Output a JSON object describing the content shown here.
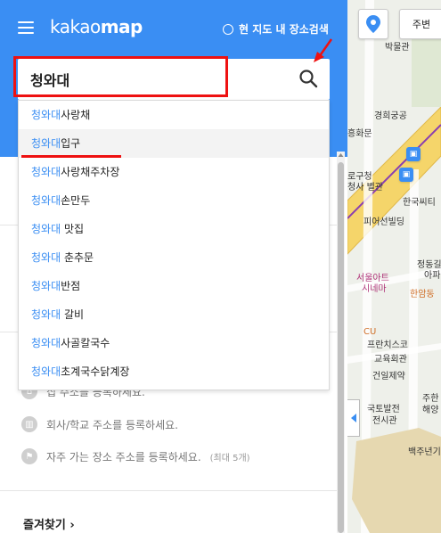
{
  "header": {
    "logo_light": "kakao",
    "logo_bold": "map",
    "area_search_label": "현 지도 내 장소검색"
  },
  "search": {
    "value": "청와대",
    "icon": "search-icon"
  },
  "suggestions": [
    {
      "highlight": "청와대",
      "rest": "사랑채"
    },
    {
      "highlight": "청와대",
      "rest": "입구"
    },
    {
      "highlight": "청와대",
      "rest": "사랑채주차장"
    },
    {
      "highlight": "청와대",
      "rest": "손만두"
    },
    {
      "highlight": "청와대",
      "rest": " 맛집"
    },
    {
      "highlight": "청와대",
      "rest": " 춘추문"
    },
    {
      "highlight": "청와대",
      "rest": "반점"
    },
    {
      "highlight": "청와대",
      "rest": " 갈비"
    },
    {
      "highlight": "청와대",
      "rest": "사골칼국수"
    },
    {
      "highlight": "청와대",
      "rest": "초계국수닭계장"
    }
  ],
  "shortcuts": {
    "home_partial": "집 주소를 등록하세요.",
    "work": "회사/학교 주소를 등록하세요.",
    "frequent": "자주 가는 장소 주소를 등록하세요.",
    "frequent_max": "(최대 5개)"
  },
  "bookmarks_label": "즐겨찾기 ›",
  "map": {
    "nearby_button": "주변",
    "labels": {
      "museum": "박물관",
      "palace": "경희궁공",
      "gate": "흥화문",
      "station_a": "로구청",
      "station_b": "청사 별관",
      "korea": "한국씨티",
      "building": "피어선빌딩",
      "art_1": "서울아트",
      "art_2": "시네마",
      "jeongdong_1": "정동길",
      "jeongdong_2": "아파",
      "hanam": "한암동",
      "cu": "CU",
      "francis_1": "프란치스코",
      "francis_2": "교육회관",
      "pharmacy": "건일제약",
      "juhan": "주한",
      "sea": "해양",
      "land_1": "국토발전",
      "land_2": "전시관",
      "baekju": "백주년기"
    }
  },
  "colors": {
    "brand": "#3a8ef3",
    "annotation": "#e11111"
  }
}
